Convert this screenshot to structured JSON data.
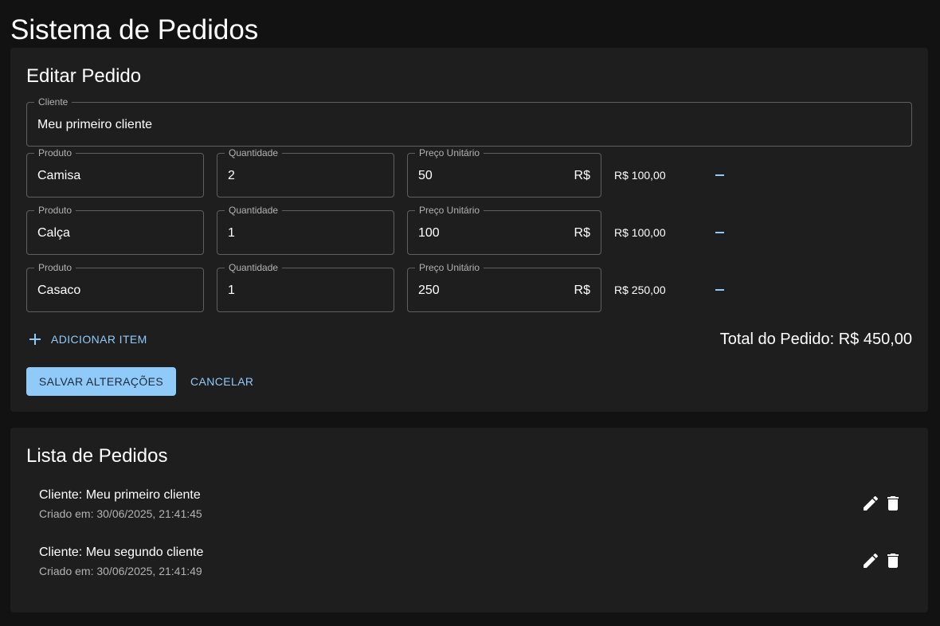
{
  "app": {
    "title": "Sistema de Pedidos"
  },
  "edit_form": {
    "title": "Editar Pedido",
    "client": {
      "label": "Cliente",
      "value": "Meu primeiro cliente"
    },
    "items": [
      {
        "product_label": "Produto",
        "product": "Camisa",
        "qty_label": "Quantidade",
        "qty": "2",
        "price_label": "Preço Unitário",
        "price": "50",
        "currency": "R$",
        "line_total": "R$ 100,00"
      },
      {
        "product_label": "Produto",
        "product": "Calça",
        "qty_label": "Quantidade",
        "qty": "1",
        "price_label": "Preço Unitário",
        "price": "100",
        "currency": "R$",
        "line_total": "R$ 100,00"
      },
      {
        "product_label": "Produto",
        "product": "Casaco",
        "qty_label": "Quantidade",
        "qty": "1",
        "price_label": "Preço Unitário",
        "price": "250",
        "currency": "R$",
        "line_total": "R$ 250,00"
      }
    ],
    "add_item_label": "ADICIONAR ITEM",
    "order_total": "Total do Pedido: R$ 450,00",
    "save_label": "SALVAR ALTERAÇÕES",
    "cancel_label": "CANCELAR"
  },
  "orders_list": {
    "title": "Lista de Pedidos",
    "orders": [
      {
        "client": "Cliente: Meu primeiro cliente",
        "created": "Criado em: 30/06/2025, 21:41:45"
      },
      {
        "client": "Cliente: Meu segundo cliente",
        "created": "Criado em: 30/06/2025, 21:41:49"
      }
    ]
  },
  "colors": {
    "background": "#121212",
    "card": "#1e1e1e",
    "accent": "#90caf9"
  },
  "icons": {
    "add": "plus-icon",
    "remove": "minus-icon",
    "edit": "pencil-icon",
    "delete": "trash-icon"
  }
}
